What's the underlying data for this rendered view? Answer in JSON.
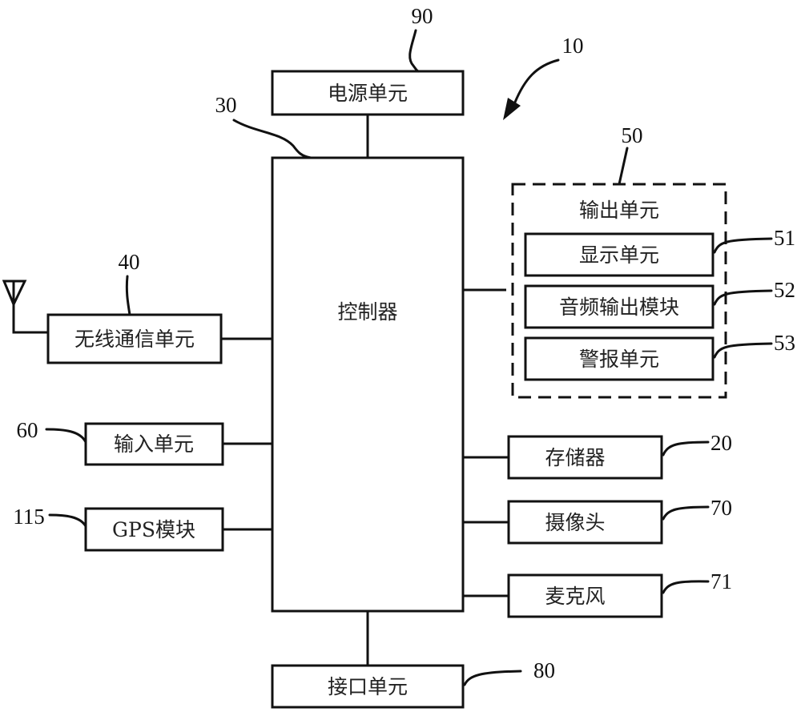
{
  "figure": {
    "reference": "10",
    "blocks": {
      "power": {
        "label": "电源单元",
        "ref": "90"
      },
      "controller": {
        "label": "控制器",
        "ref": "30"
      },
      "output": {
        "label": "输出单元",
        "ref": "50",
        "children": [
          {
            "label": "显示单元",
            "ref": "51"
          },
          {
            "label": "音频输出模块",
            "ref": "52"
          },
          {
            "label": "警报单元",
            "ref": "53"
          }
        ]
      },
      "wireless": {
        "label": "无线通信单元",
        "ref": "40"
      },
      "input": {
        "label": "输入单元",
        "ref": "60"
      },
      "gps": {
        "label": "GPS模块",
        "ref": "115"
      },
      "memory": {
        "label": "存储器",
        "ref": "20"
      },
      "camera": {
        "label": "摄像头",
        "ref": "70"
      },
      "microphone": {
        "label": "麦克风",
        "ref": "71"
      },
      "interface": {
        "label": "接口单元",
        "ref": "80"
      }
    },
    "icons": {
      "antenna": "antenna-icon",
      "pointer": "arrow-pointer-icon"
    }
  }
}
